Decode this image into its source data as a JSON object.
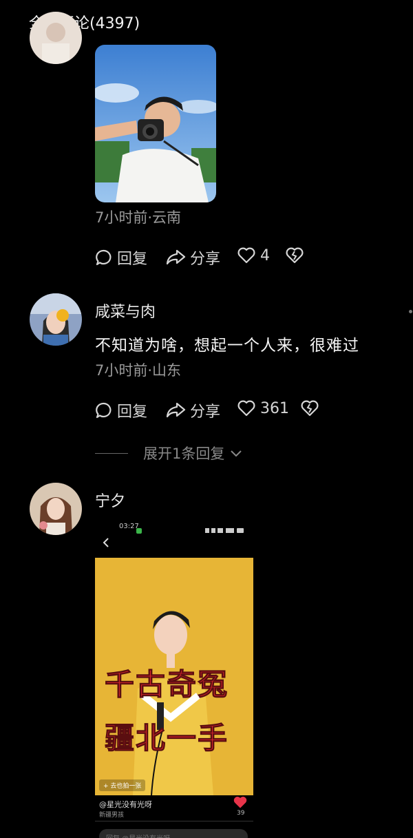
{
  "header": {
    "title": "全部评论(4397)"
  },
  "comments": [
    {
      "meta": "7小时前·云南",
      "actions": {
        "reply": "回复",
        "share": "分享",
        "likes": "4"
      }
    },
    {
      "username": "咸菜与肉",
      "text": "不知道为啥，想起一个人来，很难过",
      "meta": "7小时前·山东",
      "actions": {
        "reply": "回复",
        "share": "分享",
        "likes": "361"
      },
      "expand": "展开1条回复"
    },
    {
      "username": "宁夕",
      "screenshot": {
        "status_time": "03:27",
        "banner_line1": "千古奇冤",
        "banner_line2": "疆北一手",
        "tag": "+ 去也拍一张",
        "author": "@星光没有光呀",
        "subtitle": "新疆男孩",
        "likes": "39",
        "comment_placeholder": "回复 @星光没有光呀"
      }
    }
  ],
  "colors": {
    "background": "#000000",
    "like_heart": "#e8344a",
    "poster_bg": "#e7b536",
    "banner_red": "#d8262d"
  }
}
